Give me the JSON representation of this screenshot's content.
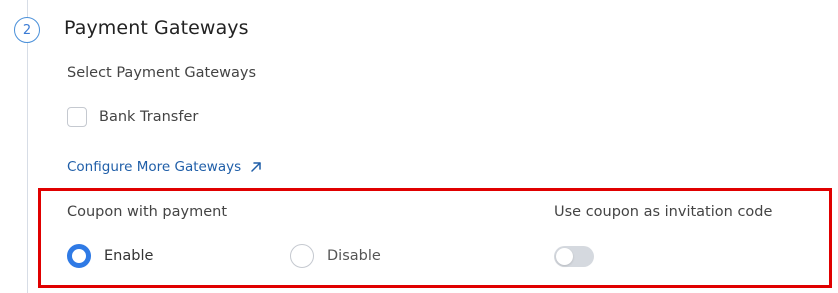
{
  "step": {
    "number": "2",
    "title": "Payment Gateways"
  },
  "gateways": {
    "subtitle": "Select Payment Gateways",
    "items": [
      {
        "label": "Bank Transfer",
        "checked": false
      }
    ],
    "configure_link": "Configure More Gateways",
    "configure_icon": "external-arrow-icon"
  },
  "coupon": {
    "label": "Coupon with payment",
    "options": [
      {
        "label": "Enable",
        "selected": true
      },
      {
        "label": "Disable",
        "selected": false
      }
    ]
  },
  "invitation": {
    "label": "Use coupon as invitation code",
    "toggle_on": false
  },
  "colors": {
    "accent": "#2f7ae5",
    "link": "#1f5ea8",
    "highlight_border": "#e00000"
  }
}
